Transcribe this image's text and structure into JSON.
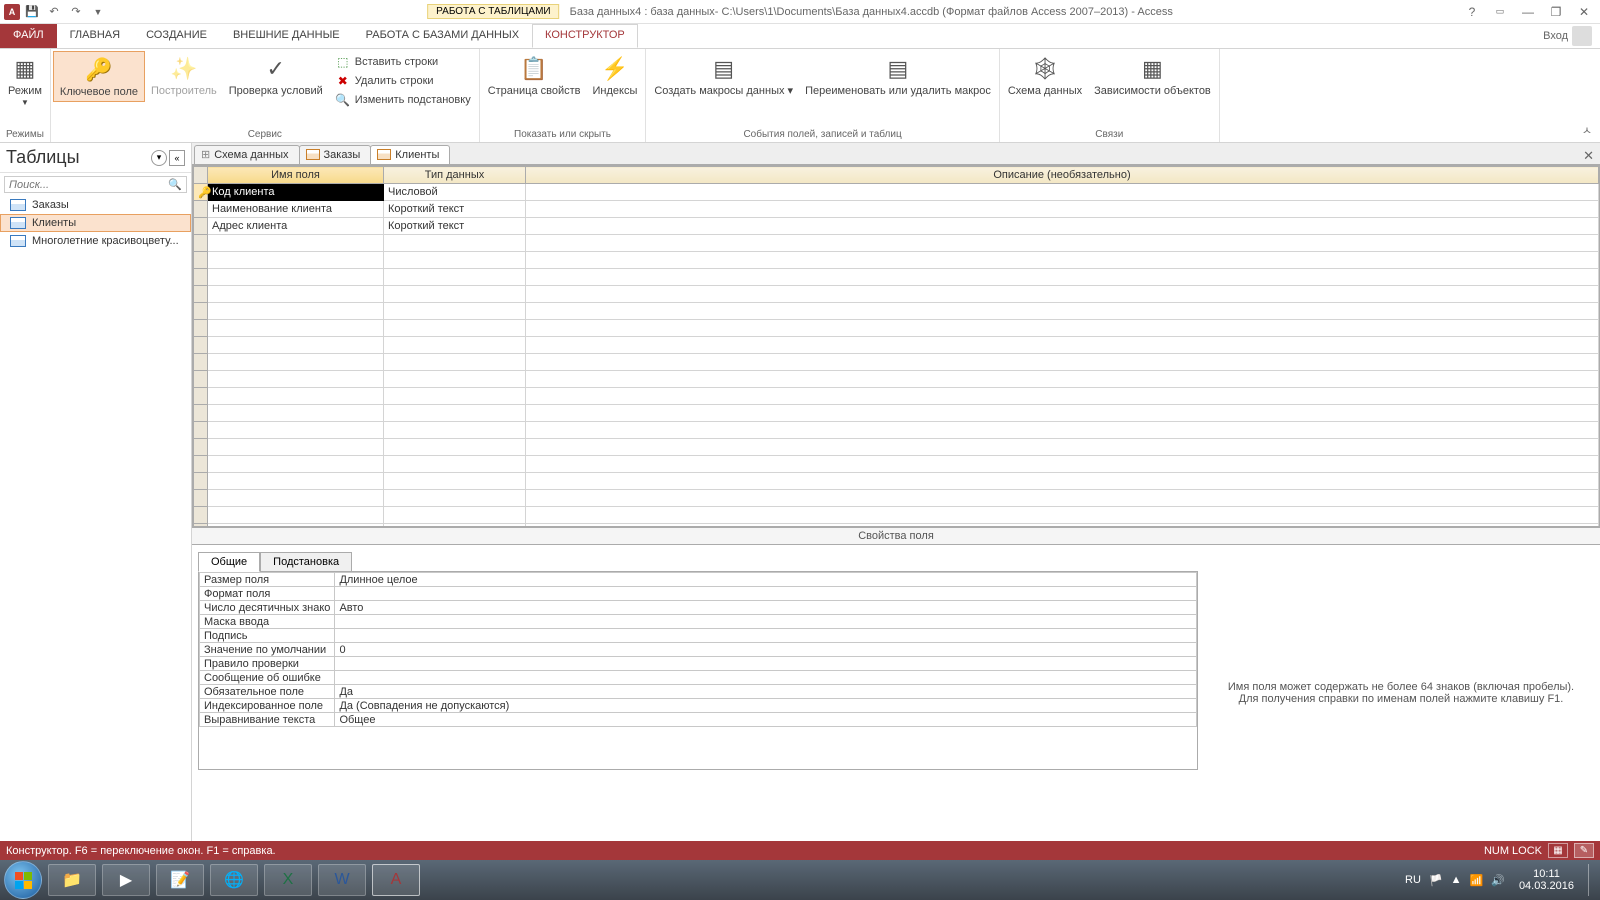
{
  "title": {
    "context_tab": "РАБОТА С ТАБЛИЦАМИ",
    "window": "База данных4 : база данных- C:\\Users\\1\\Documents\\База данных4.accdb (Формат файлов Access 2007–2013) - Access",
    "login": "Вход"
  },
  "tabs": {
    "file": "ФАЙЛ",
    "home": "ГЛАВНАЯ",
    "create": "СОЗДАНИЕ",
    "external": "ВНЕШНИЕ ДАННЫЕ",
    "dbtools": "РАБОТА С БАЗАМИ ДАННЫХ",
    "design": "КОНСТРУКТОР"
  },
  "ribbon": {
    "modes_group": "Режимы",
    "mode": "Режим",
    "key_field": "Ключевое поле",
    "builder": "Построитель",
    "test_rules": "Проверка условий",
    "insert_rows": "Вставить строки",
    "delete_rows": "Удалить строки",
    "modify_lookup": "Изменить подстановку",
    "service_group": "Сервис",
    "prop_sheet": "Страница свойств",
    "indexes": "Индексы",
    "showhide_group": "Показать или скрыть",
    "create_macros": "Создать макросы данных ▾",
    "rename_delete_macro": "Переименовать или удалить макрос",
    "events_group": "События полей, записей и таблиц",
    "schema": "Схема данных",
    "dependencies": "Зависимости объектов",
    "relations_group": "Связи"
  },
  "nav": {
    "header": "Таблицы",
    "search_placeholder": "Поиск...",
    "items": [
      "Заказы",
      "Клиенты",
      "Многолетние красивоцвету..."
    ]
  },
  "doc_tabs": [
    "Схема данных",
    "Заказы",
    "Клиенты"
  ],
  "grid": {
    "cols": [
      "Имя поля",
      "Тип данных",
      "Описание (необязательно)"
    ],
    "rows": [
      {
        "key": true,
        "name": "Код клиента",
        "type": "Числовой",
        "sel": true
      },
      {
        "key": false,
        "name": "Наименование клиента",
        "type": "Короткий текст"
      },
      {
        "key": false,
        "name": "Адрес клиента",
        "type": "Короткий текст"
      }
    ]
  },
  "props": {
    "title": "Свойства поля",
    "tabs": [
      "Общие",
      "Подстановка"
    ],
    "rows": [
      [
        "Размер поля",
        "Длинное целое"
      ],
      [
        "Формат поля",
        ""
      ],
      [
        "Число десятичных знако",
        "Авто"
      ],
      [
        "Маска ввода",
        ""
      ],
      [
        "Подпись",
        ""
      ],
      [
        "Значение по умолчании",
        "0"
      ],
      [
        "Правило проверки",
        ""
      ],
      [
        "Сообщение об ошибке",
        ""
      ],
      [
        "Обязательное поле",
        "Да"
      ],
      [
        "Индексированное поле",
        "Да (Совпадения не допускаются)"
      ],
      [
        "Выравнивание текста",
        "Общее"
      ]
    ],
    "hint": "Имя поля может содержать не более 64 знаков (включая пробелы). Для получения справки по именам полей нажмите клавишу F1."
  },
  "status": {
    "left": "Конструктор.  F6 = переключение окон.  F1 = справка.",
    "numlock": "NUM LOCK"
  },
  "taskbar": {
    "lang": "RU",
    "time": "10:11",
    "date": "04.03.2016"
  }
}
